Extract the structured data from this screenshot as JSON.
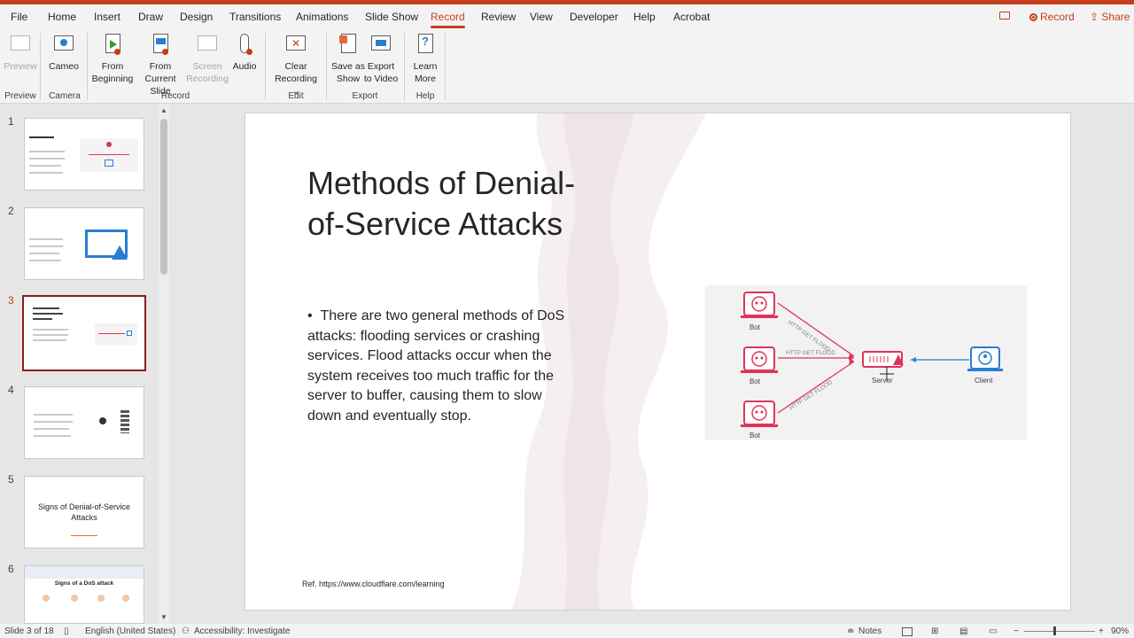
{
  "menu": {
    "tabs": [
      "File",
      "Home",
      "Insert",
      "Draw",
      "Design",
      "Transitions",
      "Animations",
      "Slide Show",
      "Record",
      "Review",
      "View",
      "Developer",
      "Help",
      "Acrobat"
    ],
    "record_label": "Record",
    "share_label": "Share"
  },
  "ribbon": {
    "preview": "Preview",
    "cameo": "Cameo",
    "from_beginning_1": "From",
    "from_beginning_2": "Beginning",
    "from_current_1": "From",
    "from_current_2": "Current Slide",
    "screen_rec_1": "Screen",
    "screen_rec_2": "Recording",
    "audio": "Audio",
    "clear_1": "Clear",
    "clear_2": "Recording",
    "save_show_1": "Save as",
    "save_show_2": "Show",
    "export_video_1": "Export",
    "export_video_2": "to Video",
    "learn_1": "Learn",
    "learn_2": "More",
    "groups": [
      "Preview",
      "Camera",
      "Record",
      "Edit",
      "Export",
      "Help"
    ]
  },
  "thumbnails": [
    {
      "number": "1",
      "text": ""
    },
    {
      "number": "2",
      "text": ""
    },
    {
      "number": "3",
      "text": ""
    },
    {
      "number": "4",
      "text": ""
    },
    {
      "number": "5",
      "text": "Signs of Denial-of-Service Attacks"
    },
    {
      "number": "6",
      "text": "Signs of a DoS attack"
    }
  ],
  "slide": {
    "title": "Methods of Denial-of-Service Attacks",
    "bullet": "There are two general methods of DoS attacks: flooding services or crashing services. Flood attacks occur when the system receives too much traffic for the server to buffer, causing them to slow down and eventually stop.",
    "ref": "Ref.  https://www.cloudflare.com/learning"
  },
  "diagram": {
    "bot_label": "Bot",
    "flood_label": "HTTP GET FLOOD",
    "server_label": "Server",
    "client_label": "Client"
  },
  "status": {
    "slide_count": "Slide 3 of 18",
    "language": "English (United States)",
    "accessibility": "Accessibility: Investigate",
    "notes": "Notes",
    "zoom": "90%"
  },
  "colors": {
    "accent": "#c43e1c",
    "diagram_red": "#e0335a",
    "diagram_blue": "#2b7cd3",
    "selected_thumb": "#8b1d1d"
  }
}
